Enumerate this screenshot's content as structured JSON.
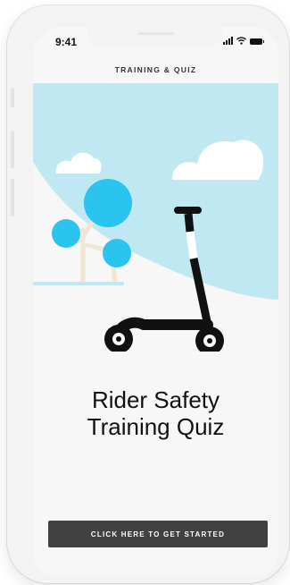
{
  "status_bar": {
    "time": "9:41",
    "icons": [
      "signal-icon",
      "wifi-icon",
      "battery-icon"
    ]
  },
  "header": {
    "title": "TRAINING & QUIZ"
  },
  "illustration": {
    "subject": "scooter-illustration",
    "colors": {
      "sky": "#bfe8f3",
      "tree": "#2ac4ee",
      "trunk": "#f1e6d6",
      "scooter": "#111111",
      "cloud": "#ffffff"
    }
  },
  "main": {
    "title_line1": "Rider Safety",
    "title_line2": "Training Quiz"
  },
  "cta": {
    "label": "CLICK HERE TO GET STARTED"
  },
  "colors": {
    "button_bg": "#414141",
    "screen_bg": "#f7f7f7",
    "device_bg": "#f3f3f3"
  }
}
